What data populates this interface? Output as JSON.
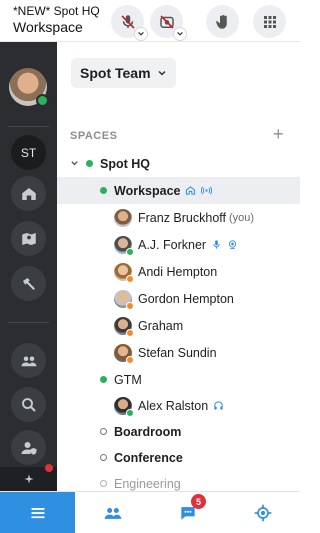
{
  "header": {
    "title_line1": "*NEW* Spot HQ",
    "title_line2": "Workspace",
    "buttons": [
      {
        "name": "mic-muted-icon",
        "has_caret": true
      },
      {
        "name": "camera-off-icon",
        "has_caret": true
      },
      {
        "name": "raise-hand-icon",
        "has_caret": false
      },
      {
        "name": "apps-grid-icon",
        "has_caret": false
      }
    ]
  },
  "rail": {
    "st_label": "ST",
    "items": [
      "home-icon",
      "map-icon",
      "hammer-icon",
      "people-icon",
      "search-icon",
      "user-shield-icon"
    ]
  },
  "main": {
    "team_label": "Spot Team",
    "spaces_label": "SPACES",
    "add_symbol": "+",
    "tree": {
      "root": "Spot HQ",
      "workspace": "Workspace",
      "members": [
        {
          "name": "Franz Bruckhoff",
          "suffix": "(you)",
          "status": "none"
        },
        {
          "name": "A.J. Forkner",
          "suffix": "",
          "status": "green"
        },
        {
          "name": "Andi Hempton",
          "suffix": "",
          "status": "orange"
        },
        {
          "name": "Gordon Hempton",
          "suffix": "",
          "status": "orange"
        },
        {
          "name": "Graham",
          "suffix": "",
          "status": "orange"
        },
        {
          "name": "Stefan Sundin",
          "suffix": "",
          "status": "orange"
        }
      ],
      "gtm": "GTM",
      "gtm_member": "Alex Ralston",
      "rooms": [
        "Boardroom",
        "Conference",
        "Engineering"
      ]
    }
  },
  "bottom": {
    "chat_badge": "5"
  },
  "colors": {
    "accent": "#2f8fe0",
    "online": "#2ab15b",
    "away": "#f08c2e",
    "alert": "#e0313a",
    "rail": "#2b2d30"
  }
}
